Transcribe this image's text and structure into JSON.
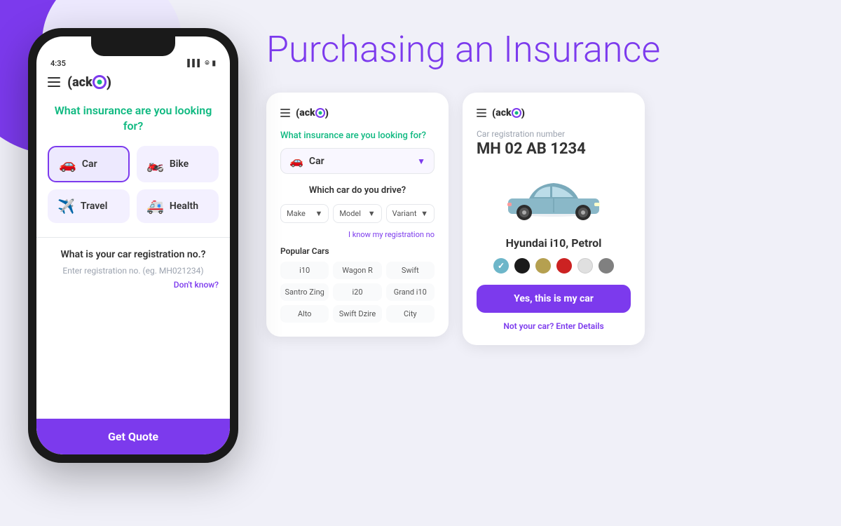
{
  "page": {
    "title": "Purchasing an Insurance",
    "background_color": "#f0f0f8"
  },
  "phone": {
    "status_bar": {
      "time": "4:35",
      "signal": "▌▌",
      "wifi": "WiFi",
      "battery": "🔋"
    },
    "logo": "acko",
    "question": "What insurance are you looking for?",
    "insurance_types": [
      {
        "id": "car",
        "label": "Car",
        "icon": "🚗",
        "selected": true
      },
      {
        "id": "bike",
        "label": "Bike",
        "icon": "🏍️",
        "selected": false
      },
      {
        "id": "travel",
        "label": "Travel",
        "icon": "✈️",
        "selected": false
      },
      {
        "id": "health",
        "label": "Health",
        "icon": "🏥",
        "selected": false
      }
    ],
    "registration": {
      "question": "What is your car registration no.?",
      "placeholder": "Enter registration no. (eg. MH021234)",
      "dont_know": "Don't know?"
    },
    "cta": "Get Quote"
  },
  "card1": {
    "question": "What insurance are you looking for?",
    "selected_type": "Car",
    "selected_icon": "🚗",
    "which_car_title": "Which car do you drive?",
    "dropdowns": [
      "Make",
      "Model",
      "Variant"
    ],
    "reg_link": "I know my registration no",
    "popular_title": "Popular Cars",
    "popular_cars": [
      "i10",
      "Wagon R",
      "Swift",
      "Santro Zing",
      "i20",
      "Grand i10",
      "Alto",
      "Swift Dzire",
      "City"
    ]
  },
  "card2": {
    "reg_label": "Car registration number",
    "reg_number": "MH 02 AB 1234",
    "car_name": "Hyundai i10, Petrol",
    "colors": [
      {
        "hex": "#6db6c9",
        "selected": true
      },
      {
        "hex": "#1a1a1a",
        "selected": false
      },
      {
        "hex": "#b5a050",
        "selected": false
      },
      {
        "hex": "#cc2222",
        "selected": false
      },
      {
        "hex": "#e0e0e0",
        "selected": false
      },
      {
        "hex": "#808080",
        "selected": false
      }
    ],
    "confirm_btn": "Yes, this is my car",
    "not_your_car_text": "Not your car?",
    "enter_details": "Enter Details"
  }
}
